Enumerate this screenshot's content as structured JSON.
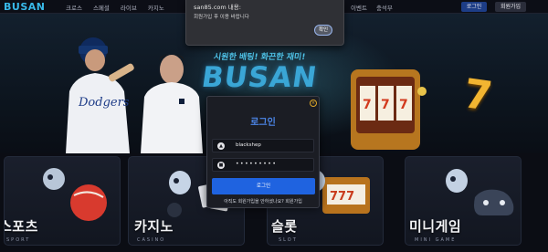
{
  "header": {
    "logo": "BUSAN",
    "nav_items": [
      "크로스",
      "스페셜",
      "라이브",
      "카지노"
    ],
    "nav_right": [
      "양",
      "이벤트",
      "충석부"
    ],
    "login_label": "로그인",
    "join_label": "회원가입"
  },
  "hero": {
    "tagline": "시원한 배팅! 화끈한 재미!",
    "brand": "BUSAN"
  },
  "cards": [
    {
      "title": "스포츠",
      "subtitle": "SPORT"
    },
    {
      "title": "카지노",
      "subtitle": "CASINO"
    },
    {
      "title": "슬롯",
      "subtitle": "SLOT"
    },
    {
      "title": "미니게임",
      "subtitle": "MINI GAME"
    }
  ],
  "alert": {
    "title": "san85.com 내용:",
    "message": "회원가입 후 이용 바랍니다",
    "ok_label": "확인"
  },
  "login_modal": {
    "title": "로그인",
    "username_value": "blackshep",
    "password_mask": "•••••••••",
    "submit_label": "로그인",
    "signup_text": "아직도 회원가입을 안하셨나요? 회원가입",
    "accent_color": "#1f63e0"
  }
}
